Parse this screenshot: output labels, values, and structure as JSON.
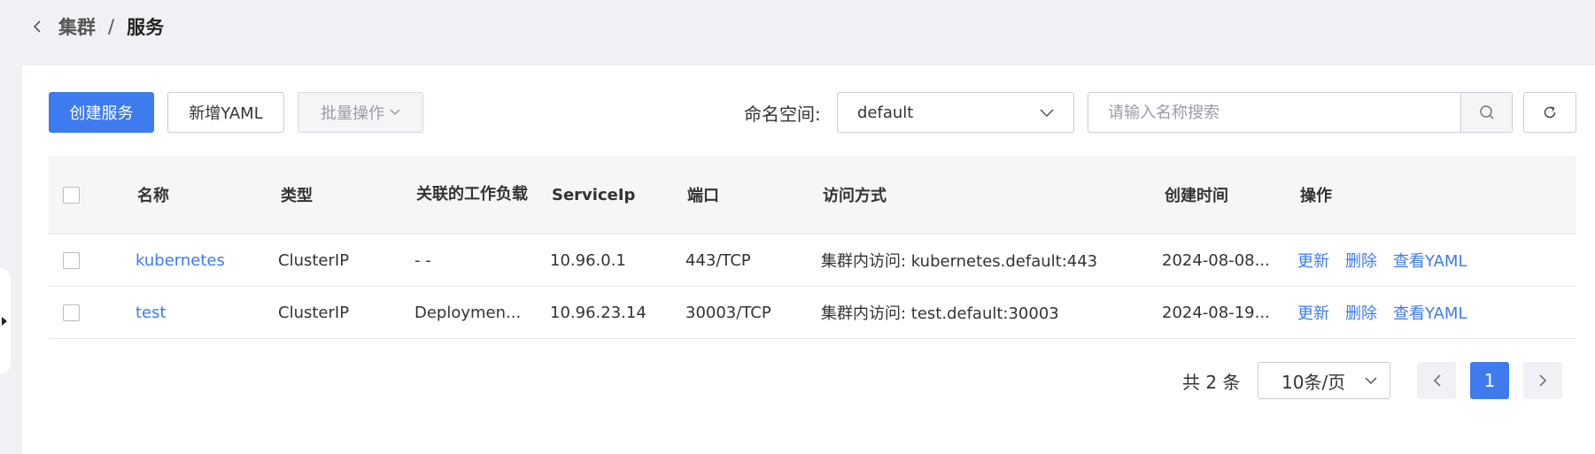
{
  "breadcrumb": {
    "parent": "集群",
    "separator": "/",
    "current": "服务"
  },
  "toolbar": {
    "create_label": "创建服务",
    "add_yaml_label": "新增YAML",
    "batch_label": "批量操作",
    "namespace_label": "命名空间:",
    "namespace_value": "default",
    "search_placeholder": "请输入名称搜索"
  },
  "table": {
    "headers": {
      "name": "名称",
      "type": "类型",
      "workload": "关联的工作负载",
      "service_ip": "ServiceIp",
      "port": "端口",
      "access": "访问方式",
      "created": "创建时间",
      "ops": "操作"
    },
    "rows": [
      {
        "name": "kubernetes",
        "type": "ClusterIP",
        "workload": "- -",
        "service_ip": "10.96.0.1",
        "port": "443/TCP",
        "access": "集群内访问: kubernetes.default:443",
        "created": "2024-08-08...",
        "update": "更新",
        "delete": "删除",
        "view_yaml": "查看YAML"
      },
      {
        "name": "test",
        "type": "ClusterIP",
        "workload": "Deploymen...",
        "service_ip": "10.96.23.14",
        "port": "30003/TCP",
        "access": "集群内访问: test.default:30003",
        "created": "2024-08-19...",
        "update": "更新",
        "delete": "删除",
        "view_yaml": "查看YAML"
      }
    ]
  },
  "pagination": {
    "total": "共 2 条",
    "page_size": "10条/页",
    "current_page": "1"
  },
  "colors": {
    "primary": "#3e7bef",
    "background": "#f0f1f4",
    "header_bg": "#f5f6f8",
    "border": "#c9ccd4"
  }
}
